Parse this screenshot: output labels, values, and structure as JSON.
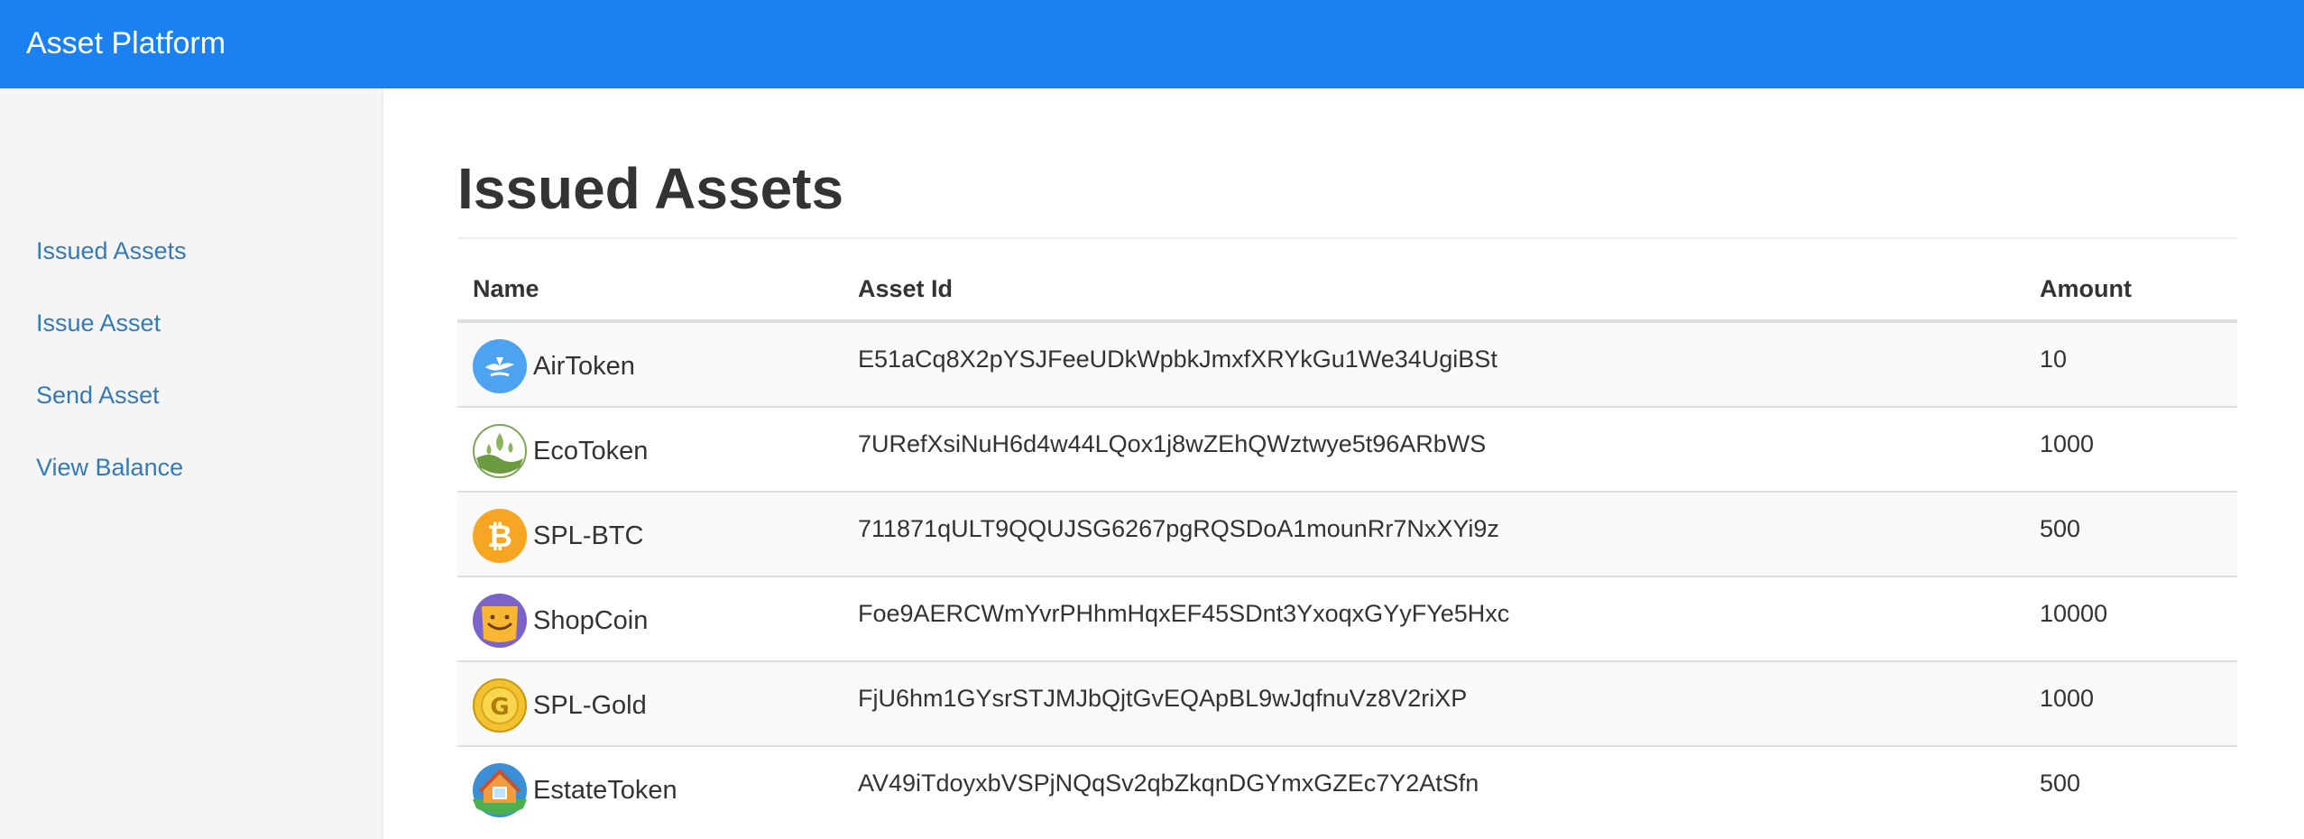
{
  "app": {
    "brand": "Asset Platform"
  },
  "sidebar": {
    "items": [
      {
        "label": "Issued Assets"
      },
      {
        "label": "Issue Asset"
      },
      {
        "label": "Send Asset"
      },
      {
        "label": "View Balance"
      }
    ]
  },
  "main": {
    "title": "Issued Assets",
    "table": {
      "headers": {
        "name": "Name",
        "asset_id": "Asset Id",
        "amount": "Amount"
      },
      "rows": [
        {
          "name": "AirToken",
          "asset_id": "E51aCq8X2pYSJFeeUDkWpbkJmxfXRYkGu1We34UgiBSt",
          "amount": "10",
          "icon": "air-token-icon"
        },
        {
          "name": "EcoToken",
          "asset_id": "7URefXsiNuH6d4w44LQox1j8wZEhQWztwye5t96ARbWS",
          "amount": "1000",
          "icon": "eco-token-icon"
        },
        {
          "name": "SPL-BTC",
          "asset_id": "711871qULT9QQUJSG6267pgRQSDoA1mounRr7NxXYi9z",
          "amount": "500",
          "icon": "bitcoin-icon"
        },
        {
          "name": "ShopCoin",
          "asset_id": "Foe9AERCWmYvrPHhmHqxEF45SDnt3YxoqxGYyFYe5Hxc",
          "amount": "10000",
          "icon": "shopcoin-icon"
        },
        {
          "name": "SPL-Gold",
          "asset_id": "FjU6hm1GYsrSTJMJbQjtGvEQApBL9wJqfnuVz8V2riXP",
          "amount": "1000",
          "icon": "gold-coin-icon"
        },
        {
          "name": "EstateToken",
          "asset_id": "AV49iTdoyxbVSPjNQqSv2qbZkqnDGYmxGZEc7Y2AtSfn",
          "amount": "500",
          "icon": "house-icon"
        }
      ]
    }
  },
  "colors": {
    "topbar": "#1b81f0",
    "link": "#337ab7",
    "sidebar_bg": "#f5f5f5",
    "row_stripe": "#f9f9f9"
  }
}
